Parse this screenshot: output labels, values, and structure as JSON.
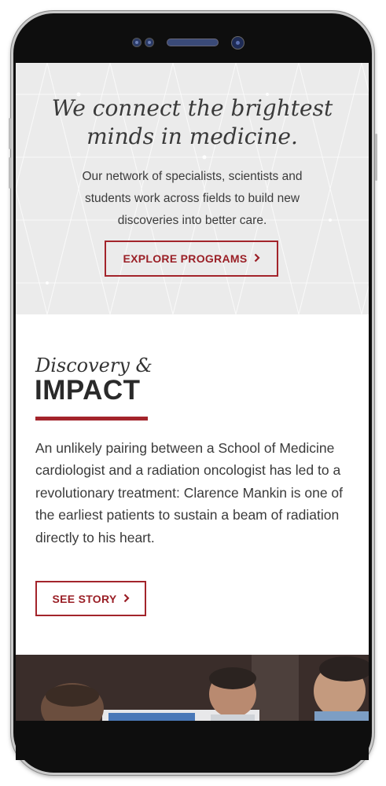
{
  "hero": {
    "title_line1": "We connect the brightest",
    "title_line2": "minds in medicine.",
    "text": "Our network of specialists, scientists and students work across fields to build new discoveries into better care.",
    "button_label": "EXPLORE PROGRAMS",
    "button_chevron": "›"
  },
  "discovery": {
    "script_heading": "Discovery &",
    "bold_heading": "IMPACT",
    "body": "An unlikely pairing between a School of Medicine cardiologist and a radiation oncologist has led to a revolutionary treatment: Clarence Mankin is one of the earliest patients to sustain a beam of radiation directly to his heart.",
    "button_label": "SEE STORY",
    "button_chevron": "›"
  },
  "colors": {
    "accent": "#a3242b",
    "hero_bg": "#ebebeb",
    "text": "#3a3a3a"
  }
}
